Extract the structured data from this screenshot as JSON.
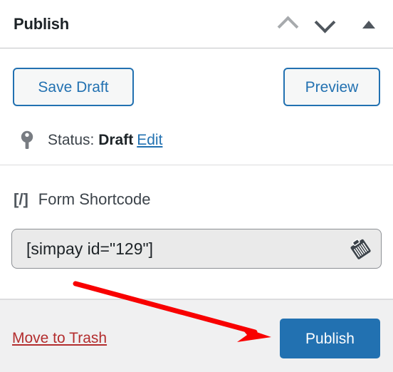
{
  "panel": {
    "title": "Publish",
    "header_icons": [
      {
        "name": "order-higher-icon",
        "glyph": "chevron-up"
      },
      {
        "name": "order-lower-icon",
        "glyph": "chevron-down"
      },
      {
        "name": "toggle-panel-icon",
        "glyph": "triangle-up"
      }
    ]
  },
  "minor_actions": {
    "save_draft_label": "Save Draft",
    "preview_label": "Preview"
  },
  "status": {
    "icon": "post-status-pin-icon",
    "label": "Status:",
    "value": "Draft",
    "edit_link": "Edit"
  },
  "shortcode": {
    "icon": "[/]",
    "icon_name": "shortcode-brackets-icon",
    "heading": "Form Shortcode",
    "value": "[simpay id=\"129\"]",
    "placeholder": "[simpay id=\"129\"]",
    "copy_icon": "copy-clipboard-icon"
  },
  "major_actions": {
    "trash_label": "Move to Trash",
    "publish_label": "Publish"
  },
  "annotation": {
    "type": "arrow",
    "color": "#f80000",
    "points_to": "publish-button"
  },
  "colors": {
    "accent_blue": "#2271b1",
    "danger_red": "#b32d2e",
    "annotation_red": "#f80000",
    "text_dark": "#1d2327",
    "text_muted": "#3c434a",
    "footer_bg": "#f0f0f1",
    "field_bg": "#eaeaea",
    "border": "#dcdcde"
  }
}
